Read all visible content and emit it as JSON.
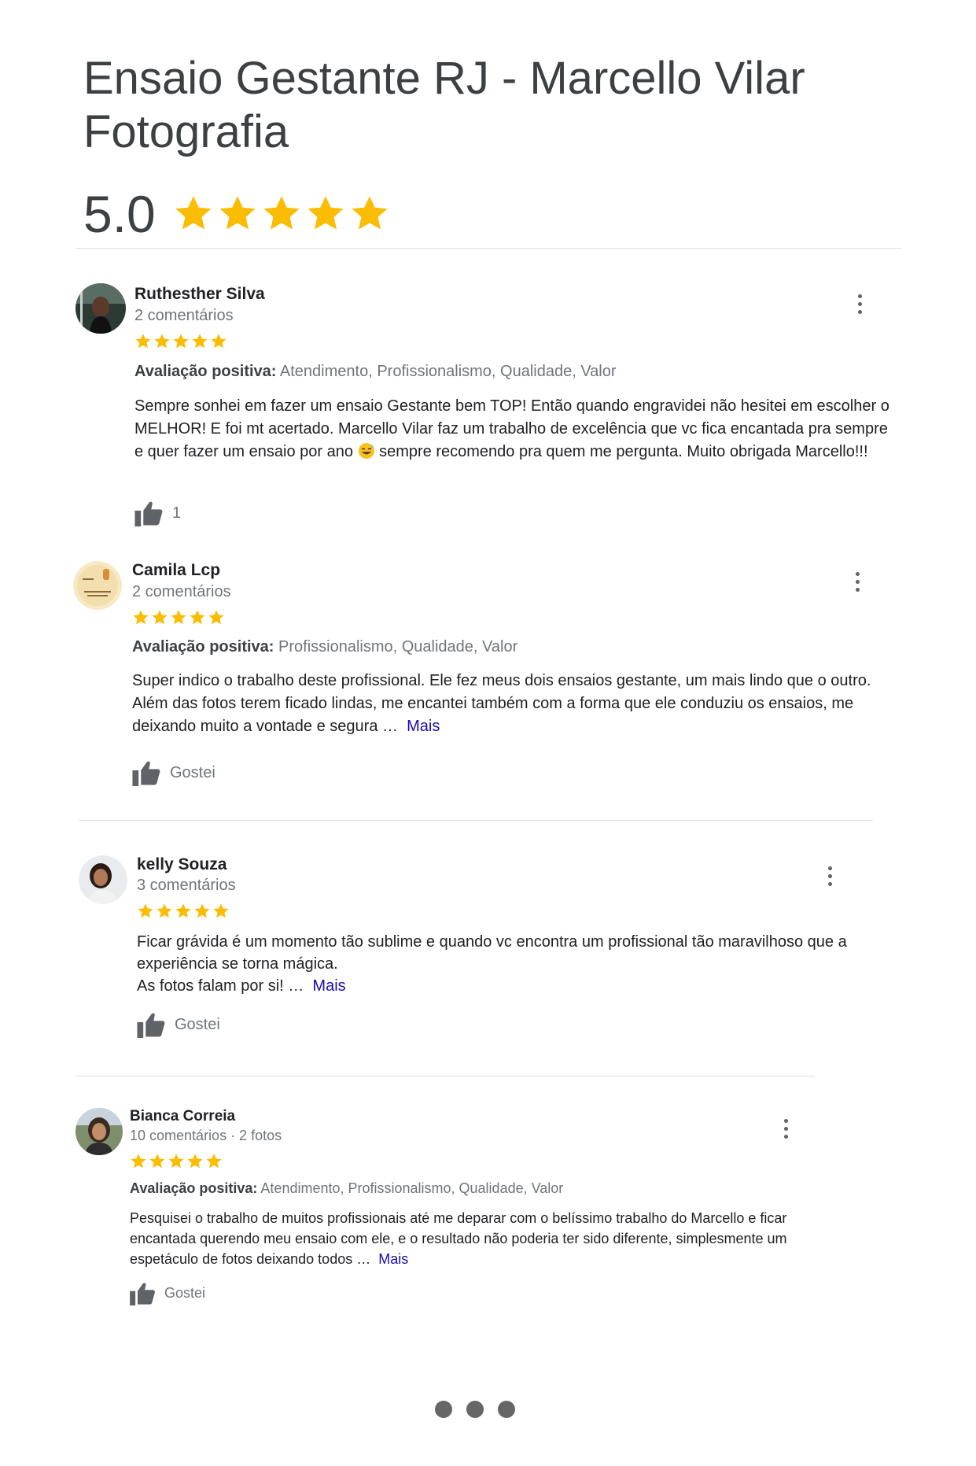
{
  "header": {
    "title": "Ensaio Gestante RJ - Marcello Vilar Fotografia",
    "rating": "5.0",
    "star_count": 5,
    "star_color": "#fbbc04"
  },
  "reviews": [
    {
      "name": "Ruthesther Silva",
      "meta": "2 comentários",
      "stars": 5,
      "attr_label": "Avaliação positiva:",
      "attr_values": "Atendimento, Profissionalismo, Qualidade, Valor",
      "text_part1": "Sempre sonhei em fazer um ensaio Gestante bem TOP! Então quando engravidei não hesitei em escolher o MELHOR! E foi mt acertado. Marcello Vilar faz um trabalho de excelência que vc fica encantada pra sempre e quer fazer um ensaio por ano",
      "emoji": "sweat-smile-emoji",
      "text_part2": "sempre recomendo pra quem me pergunta. Muito obrigada Marcello!!!",
      "like_label": "1"
    },
    {
      "name": "Camila Lcp",
      "meta": "2 comentários",
      "stars": 5,
      "attr_label": "Avaliação positiva:",
      "attr_values": "Profissionalismo, Qualidade, Valor",
      "text": "Super indico o trabalho deste profissional. Ele fez meus dois ensaios gestante, um mais lindo que o outro. Além das fotos terem ficado lindas, me encantei também com a forma que ele conduziu os ensaios, me deixando muito a vontade e segura …",
      "more": "Mais",
      "like_label": "Gostei"
    },
    {
      "name": "kelly Souza",
      "meta": "3 comentários",
      "stars": 5,
      "text_line1": "Ficar grávida é um momento tão sublime e quando vc encontra um profissional tão maravilhoso que a experiência se torna mágica.",
      "text_line2": "As fotos falam por si! …",
      "more": "Mais",
      "like_label": "Gostei"
    },
    {
      "name": "Bianca Correia",
      "meta": "10 comentários · 2 fotos",
      "stars": 5,
      "attr_label": "Avaliação positiva:",
      "attr_values": "Atendimento, Profissionalismo, Qualidade, Valor",
      "text": "Pesquisei o trabalho de muitos profissionais até me deparar com o belíssimo trabalho do Marcello e ficar encantada querendo meu ensaio com ele, e o resultado não poderia ter sido diferente, simplesmente um espetáculo de fotos deixando todos …",
      "more": "Mais",
      "like_label": "Gostei"
    }
  ],
  "pager": {
    "dots": 3,
    "dot_color": "#666666"
  }
}
